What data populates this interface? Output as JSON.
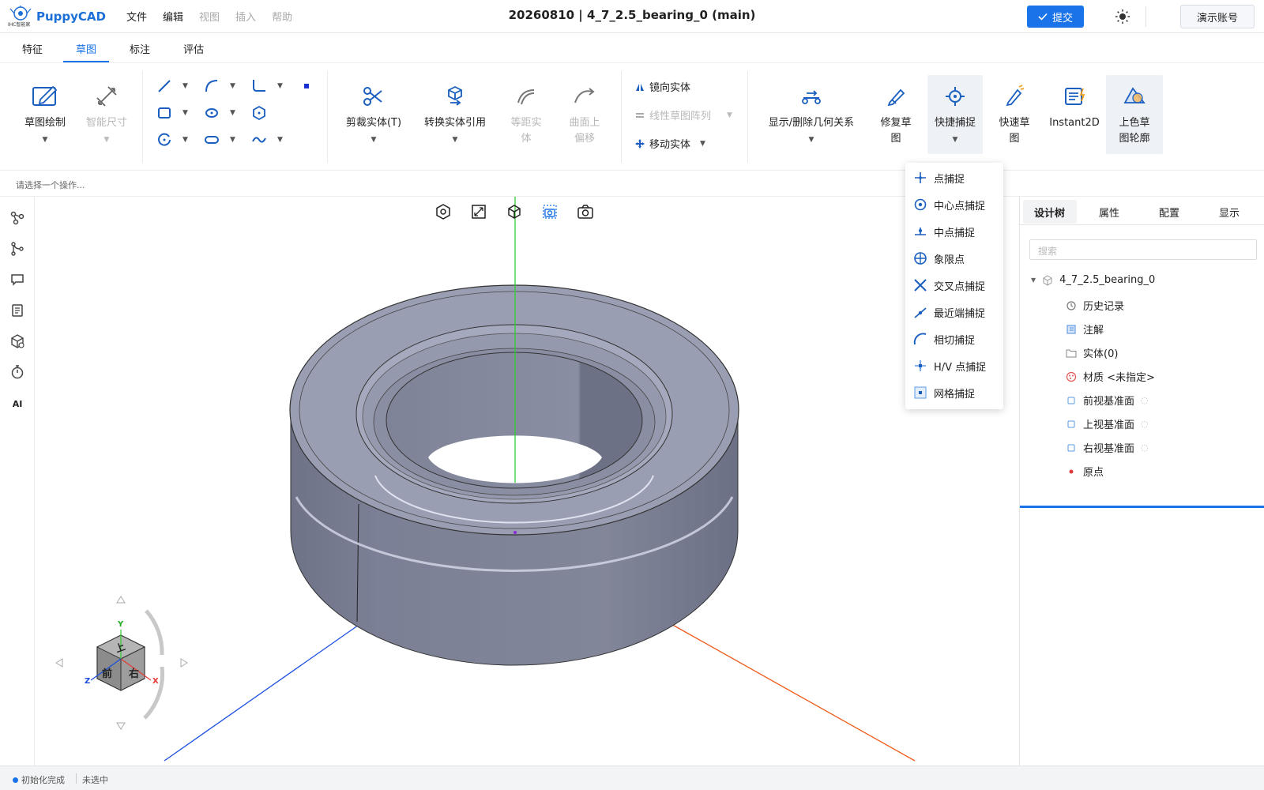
{
  "app": {
    "name": "PuppyCAD",
    "logo_subtext": "IHC智能家"
  },
  "menu": {
    "file": "文件",
    "edit": "编辑",
    "view": "视图",
    "insert": "插入",
    "help": "帮助"
  },
  "doc_title": "20260810 | 4_7_2.5_bearing_0  (main)",
  "header": {
    "submit_label": "提交",
    "account_label": "演示账号",
    "theme_icon": "sun-icon"
  },
  "tabs": {
    "feature": "特征",
    "sketch": "草图",
    "annotate": "标注",
    "evaluate": "评估",
    "active": "草图"
  },
  "ribbon": {
    "sketch_draw": "草图绘制",
    "smart_dimension": "智能尺寸",
    "trim": "剪裁实体(T)",
    "convert": "转换实体引用",
    "offset_line1": "等距实",
    "offset_line2": "体",
    "surface_line1": "曲面上",
    "surface_line2": "偏移",
    "mirror": "镜向实体",
    "linear_pattern": "线性草图阵列",
    "move": "移动实体",
    "relations": "显示/删除几何关系",
    "repair_line1": "修复草",
    "repair_line2": "图",
    "quick_snap": "快捷捕捉",
    "quick_sketch_line1": "快速草",
    "quick_sketch_line2": "图",
    "instant2d": "Instant2D",
    "shaded_line1": "上色草",
    "shaded_line2": "图轮廓"
  },
  "hint": "请选择一个操作...",
  "leftbar": {
    "ai_label": "AI"
  },
  "snap_menu": [
    {
      "label": "点捕捉",
      "icon": "point-snap-icon"
    },
    {
      "label": "中心点捕捉",
      "icon": "center-snap-icon"
    },
    {
      "label": "中点捕捉",
      "icon": "midpoint-snap-icon"
    },
    {
      "label": "象限点",
      "icon": "quadrant-snap-icon"
    },
    {
      "label": "交叉点捕捉",
      "icon": "intersection-snap-icon"
    },
    {
      "label": "最近端捕捉",
      "icon": "nearest-snap-icon"
    },
    {
      "label": "相切捕捉",
      "icon": "tangent-snap-icon"
    },
    {
      "label": "H/V 点捕捉",
      "icon": "hv-snap-icon"
    },
    {
      "label": "网格捕捉",
      "icon": "grid-snap-icon"
    }
  ],
  "right_panel": {
    "tabs": {
      "tree": "设计树",
      "props": "属性",
      "config": "配置",
      "display": "显示"
    },
    "search_placeholder": "搜索",
    "tree": {
      "root": "4_7_2.5_bearing_0",
      "history": "历史记录",
      "annotation": "注解",
      "solid": "实体(0)",
      "material": "材质 <未指定>",
      "front_plane": "前视基准面",
      "top_plane": "上视基准面",
      "right_plane": "右视基准面",
      "origin": "原点"
    }
  },
  "viewcube": {
    "top": "上",
    "front": "前",
    "right": "右",
    "axis_x": "X",
    "axis_y": "Y",
    "axis_z": "Z"
  },
  "status": {
    "init": "初始化完成",
    "selection": "未选中"
  },
  "colors": {
    "accent": "#1a73e8",
    "model": "#7e8298",
    "axis_y": "#33cc33",
    "axis_z": "#1a4fe0",
    "axis_x": "#f05a1a"
  }
}
